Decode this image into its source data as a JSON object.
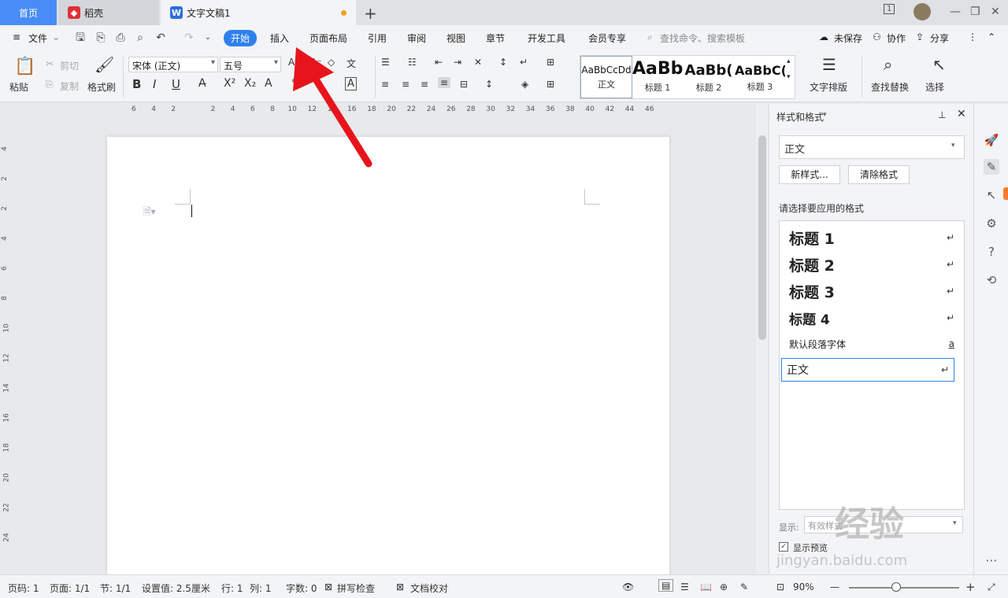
{
  "tabs": {
    "home": "首页",
    "daoke": "稻壳",
    "doc": "文字文稿1",
    "new": "+"
  },
  "menu": {
    "file": "文件",
    "items": [
      "开始",
      "插入",
      "页面布局",
      "引用",
      "审阅",
      "视图",
      "章节",
      "开发工具",
      "会员专享"
    ],
    "search": "查找命令、搜索模板",
    "unsaved": "未保存",
    "collab": "协作",
    "share": "分享"
  },
  "ribbon": {
    "paste": "粘贴",
    "cut": "剪切",
    "copy": "复制",
    "format_painter": "格式刷",
    "font": "宋体 (正文)",
    "size": "五号",
    "gallery": [
      {
        "preview": "AaBbCcDd",
        "label": "正文"
      },
      {
        "preview": "AaBb",
        "label": "标题 1"
      },
      {
        "preview": "AaBb(",
        "label": "标题 2"
      },
      {
        "preview": "AaBbC(",
        "label": "标题 3"
      }
    ],
    "text_layout": "文字排版",
    "find_replace": "查找替换",
    "select": "选择"
  },
  "ruler": {
    "numbers": [
      "6",
      "4",
      "2",
      "2",
      "4",
      "6",
      "8",
      "10",
      "12",
      "14",
      "16",
      "18",
      "20",
      "22",
      "24",
      "26",
      "28",
      "30",
      "32",
      "34",
      "36",
      "38",
      "40",
      "42",
      "44",
      "46"
    ],
    "v_numbers": [
      "4",
      "2",
      "2",
      "4",
      "6",
      "8",
      "10",
      "12",
      "14",
      "16",
      "18",
      "20",
      "22",
      "24"
    ]
  },
  "pane": {
    "title": "样式和格式",
    "current": "正文",
    "new_style": "新样式...",
    "clear": "清除格式",
    "prompt": "请选择要应用的格式",
    "styles": [
      {
        "name": "标题  1",
        "mark": "↵"
      },
      {
        "name": "标题  2",
        "mark": "↵"
      },
      {
        "name": "标题  3",
        "mark": "↵"
      },
      {
        "name": "标题  4",
        "mark": "↵"
      },
      {
        "name": "默认段落字体",
        "mark": "a"
      },
      {
        "name": "正文",
        "mark": "↵"
      }
    ],
    "show_label": "显示:",
    "show_value": "有效样式",
    "preview": "显示预览"
  },
  "status": {
    "page_num": "页码: 1",
    "pages": "页面: 1/1",
    "section": "节: 1/1",
    "setting": "设置值: 2.5厘米",
    "row": "行: 1",
    "col": "列: 1",
    "words": "字数: 0",
    "spell": "拼写检查",
    "proof": "文档校对",
    "zoom": "90%"
  },
  "watermark": {
    "text": "经验",
    "url": "jingyan.baidu.com"
  },
  "colors": {
    "accent": "#2f80ed",
    "home_tab": "#4a8cf7",
    "arrow": "#e8141c"
  }
}
